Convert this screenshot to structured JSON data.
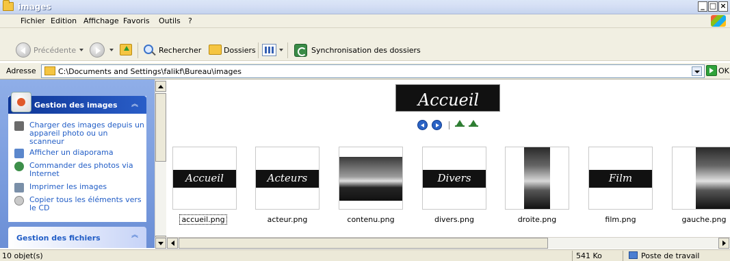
{
  "window": {
    "title": "images"
  },
  "menu": [
    "Fichier",
    "Edition",
    "Affichage",
    "Favoris",
    "Outils",
    "?"
  ],
  "toolbar": {
    "back_label": "Précédente",
    "search_label": "Rechercher",
    "folders_label": "Dossiers",
    "sync_label": "Synchronisation des dossiers"
  },
  "address": {
    "label": "Adresse",
    "path": "C:\\Documents and Settings\\falikf\\Bureau\\images",
    "go_label": "OK"
  },
  "taskpane": {
    "image_tasks": {
      "title": "Gestion des images",
      "items": [
        {
          "label": "Charger des images depuis un appareil photo ou un scanneur",
          "icon": "camera-icon"
        },
        {
          "label": "Afficher un diaporama",
          "icon": "slideshow-icon"
        },
        {
          "label": "Commander des photos via Internet",
          "icon": "order-photos-icon"
        },
        {
          "label": "Imprimer les images",
          "icon": "printer-icon"
        },
        {
          "label": "Copier tous les éléments vers le CD",
          "icon": "cd-icon"
        }
      ]
    },
    "file_tasks": {
      "title": "Gestion des fichiers"
    }
  },
  "preview": {
    "text": "Accueil"
  },
  "files": [
    {
      "name": "accueil.png",
      "thumb": "Accueil",
      "selected": true
    },
    {
      "name": "acteur.png",
      "thumb": "Acteurs"
    },
    {
      "name": "contenu.png",
      "thumb": ""
    },
    {
      "name": "divers.png",
      "thumb": "Divers"
    },
    {
      "name": "droite.png",
      "thumb": ""
    },
    {
      "name": "film.png",
      "thumb": "Film"
    },
    {
      "name": "gauche.png",
      "thumb": ""
    }
  ],
  "status": {
    "objects": "10 objet(s)",
    "size": "541 Ko",
    "location": "Poste de travail"
  }
}
